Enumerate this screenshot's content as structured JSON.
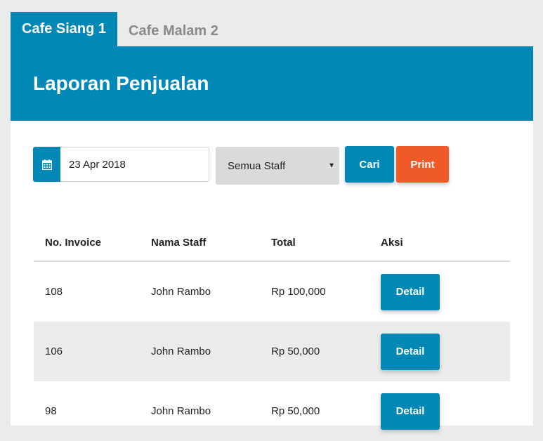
{
  "tabs": [
    {
      "label": "Cafe Siang 1",
      "active": true
    },
    {
      "label": "Cafe Malam 2",
      "active": false
    }
  ],
  "panel": {
    "title": "Laporan Penjualan"
  },
  "filters": {
    "date_value": "23 Apr 2018",
    "staff_selected": "Semua Staff",
    "search_label": "Cari",
    "print_label": "Print",
    "date_icon": "calendar-icon"
  },
  "table": {
    "headers": [
      "No. Invoice",
      "Nama Staff",
      "Total",
      "Aksi"
    ],
    "rows": [
      {
        "invoice": "108",
        "staff": "John Rambo",
        "total": "Rp 100,000",
        "action": "Detail"
      },
      {
        "invoice": "106",
        "staff": "John Rambo",
        "total": "Rp 50,000",
        "action": "Detail"
      },
      {
        "invoice": "98",
        "staff": "John Rambo",
        "total": "Rp 50,000",
        "action": "Detail"
      }
    ]
  },
  "colors": {
    "primary": "#0188b7",
    "print": "#f05a28",
    "select_bg": "#dadada",
    "stripe": "#ebebeb"
  }
}
